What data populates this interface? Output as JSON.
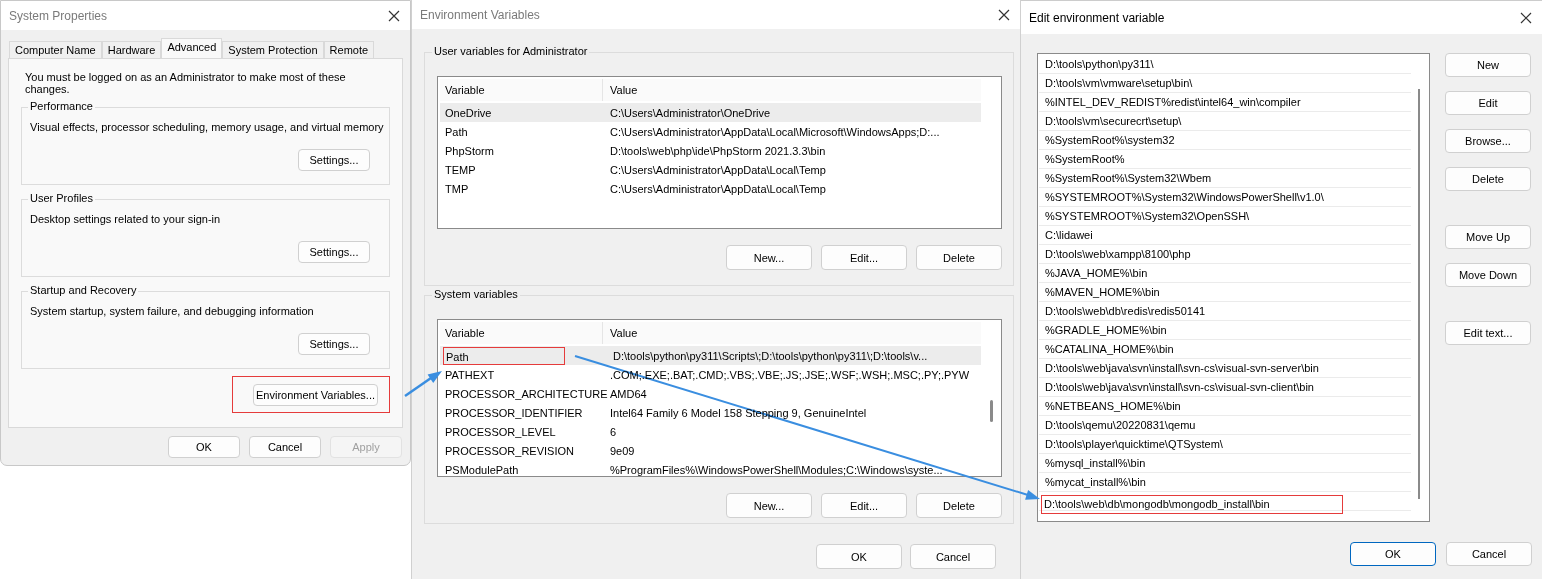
{
  "system_properties": {
    "title": "System Properties",
    "tabs": [
      {
        "label": "Computer Name",
        "selected": false
      },
      {
        "label": "Hardware",
        "selected": false
      },
      {
        "label": "Advanced",
        "selected": true
      },
      {
        "label": "System Protection",
        "selected": false
      },
      {
        "label": "Remote",
        "selected": false
      }
    ],
    "notice": "You must be logged on as an Administrator to make most of these changes.",
    "groups": [
      {
        "title": "Performance",
        "description": "Visual effects, processor scheduling, memory usage, and virtual memory",
        "button": "Settings..."
      },
      {
        "title": "User Profiles",
        "description": "Desktop settings related to your sign-in",
        "button": "Settings..."
      },
      {
        "title": "Startup and Recovery",
        "description": "System startup, system failure, and debugging information",
        "button": "Settings..."
      }
    ],
    "env_button": {
      "label": "Environment Variables...",
      "highlighted": true
    },
    "buttons": [
      {
        "label": "OK",
        "disabled": false
      },
      {
        "label": "Cancel",
        "disabled": false
      },
      {
        "label": "Apply",
        "disabled": true
      }
    ]
  },
  "environment_variables": {
    "title": "Environment Variables",
    "sections": [
      {
        "title": "User variables for Administrator",
        "columns": [
          "Variable",
          "Value"
        ],
        "scrollbar": false,
        "rows": [
          {
            "variable": "OneDrive",
            "value": "C:\\Users\\Administrator\\OneDrive",
            "selected": true,
            "highlighted": false
          },
          {
            "variable": "Path",
            "value": "C:\\Users\\Administrator\\AppData\\Local\\Microsoft\\WindowsApps;D:...",
            "selected": false,
            "highlighted": false
          },
          {
            "variable": "PhpStorm",
            "value": "D:\\tools\\web\\php\\ide\\PhpStorm 2021.3.3\\bin",
            "selected": false,
            "highlighted": false
          },
          {
            "variable": "TEMP",
            "value": "C:\\Users\\Administrator\\AppData\\Local\\Temp",
            "selected": false,
            "highlighted": false
          },
          {
            "variable": "TMP",
            "value": "C:\\Users\\Administrator\\AppData\\Local\\Temp",
            "selected": false,
            "highlighted": false
          }
        ],
        "buttons": [
          "New...",
          "Edit...",
          "Delete"
        ]
      },
      {
        "title": "System variables",
        "columns": [
          "Variable",
          "Value"
        ],
        "scrollbar": true,
        "rows": [
          {
            "variable": "Path",
            "value": "D:\\tools\\python\\py311\\Scripts\\;D:\\tools\\python\\py311\\;D:\\tools\\v...",
            "selected": true,
            "highlighted": true
          },
          {
            "variable": "PATHEXT",
            "value": ".COM;.EXE;.BAT;.CMD;.VBS;.VBE;.JS;.JSE;.WSF;.WSH;.MSC;.PY;.PYW",
            "selected": false,
            "highlighted": false
          },
          {
            "variable": "PROCESSOR_ARCHITECTURE",
            "value": "AMD64",
            "selected": false,
            "highlighted": false
          },
          {
            "variable": "PROCESSOR_IDENTIFIER",
            "value": "Intel64 Family 6 Model 158 Stepping 9, GenuineIntel",
            "selected": false,
            "highlighted": false
          },
          {
            "variable": "PROCESSOR_LEVEL",
            "value": "6",
            "selected": false,
            "highlighted": false
          },
          {
            "variable": "PROCESSOR_REVISION",
            "value": "9e09",
            "selected": false,
            "highlighted": false
          },
          {
            "variable": "PSModulePath",
            "value": "%ProgramFiles%\\WindowsPowerShell\\Modules;C:\\Windows\\syste...",
            "selected": false,
            "highlighted": false
          }
        ],
        "buttons": [
          "New...",
          "Edit...",
          "Delete"
        ]
      }
    ],
    "buttons": [
      "OK",
      "Cancel"
    ]
  },
  "edit_variable": {
    "title": "Edit environment variable",
    "entries": [
      {
        "text": "D:\\tools\\python\\py311\\",
        "highlighted": false
      },
      {
        "text": "D:\\tools\\vm\\vmware\\setup\\bin\\",
        "highlighted": false
      },
      {
        "text": "%INTEL_DEV_REDIST%redist\\intel64_win\\compiler",
        "highlighted": false
      },
      {
        "text": "D:\\tools\\vm\\securecrt\\setup\\",
        "highlighted": false
      },
      {
        "text": "%SystemRoot%\\system32",
        "highlighted": false
      },
      {
        "text": "%SystemRoot%",
        "highlighted": false
      },
      {
        "text": "%SystemRoot%\\System32\\Wbem",
        "highlighted": false
      },
      {
        "text": "%SYSTEMROOT%\\System32\\WindowsPowerShell\\v1.0\\",
        "highlighted": false
      },
      {
        "text": "%SYSTEMROOT%\\System32\\OpenSSH\\",
        "highlighted": false
      },
      {
        "text": "C:\\lidawei",
        "highlighted": false
      },
      {
        "text": "D:\\tools\\web\\xampp\\8100\\php",
        "highlighted": false
      },
      {
        "text": "%JAVA_HOME%\\bin",
        "highlighted": false
      },
      {
        "text": "%MAVEN_HOME%\\bin",
        "highlighted": false
      },
      {
        "text": "D:\\tools\\web\\db\\redis\\redis50141",
        "highlighted": false
      },
      {
        "text": "%GRADLE_HOME%\\bin",
        "highlighted": false
      },
      {
        "text": "%CATALINA_HOME%\\bin",
        "highlighted": false
      },
      {
        "text": "D:\\tools\\web\\java\\svn\\install\\svn-cs\\visual-svn-server\\bin",
        "highlighted": false
      },
      {
        "text": "D:\\tools\\web\\java\\svn\\install\\svn-cs\\visual-svn-client\\bin",
        "highlighted": false
      },
      {
        "text": "%NETBEANS_HOME%\\bin",
        "highlighted": false
      },
      {
        "text": "D:\\tools\\qemu\\20220831\\qemu",
        "highlighted": false
      },
      {
        "text": "D:\\tools\\player\\quicktime\\QTSystem\\",
        "highlighted": false
      },
      {
        "text": "%mysql_install%\\bin",
        "highlighted": false
      },
      {
        "text": "%mycat_install%\\bin",
        "highlighted": false
      },
      {
        "text": "D:\\tools\\web\\db\\mongodb\\mongodb_install\\bin",
        "highlighted": true
      }
    ],
    "button_groups": [
      [
        "New",
        "Edit",
        "Browse...",
        "Delete"
      ],
      [
        "Move Up",
        "Move Down"
      ],
      [
        "Edit text..."
      ]
    ],
    "footer_buttons": [
      {
        "label": "OK",
        "default": true
      },
      {
        "label": "Cancel",
        "default": false
      }
    ]
  }
}
